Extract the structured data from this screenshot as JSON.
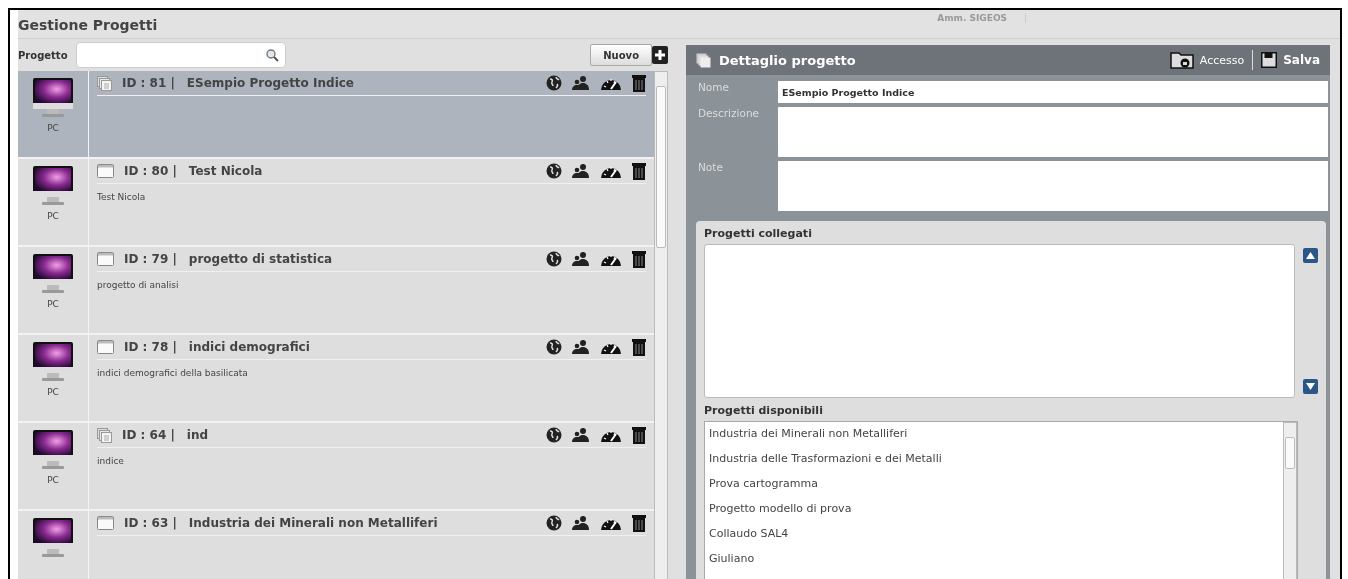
{
  "header": {
    "title": "Gestione Progetti",
    "user": "Amm. SIGEOS"
  },
  "search": {
    "label": "Progetto"
  },
  "new_button": "Nuovo",
  "projects": [
    {
      "kind": "stack",
      "id": "ID : 81 |",
      "name": "ESempio Progetto Indice",
      "device": "PC",
      "selected": true
    },
    {
      "kind": "window",
      "id": "ID : 80 |",
      "name": "Test Nicola",
      "description": "Test Nicola",
      "device": "PC",
      "selected": false
    },
    {
      "kind": "window",
      "id": "ID : 79 |",
      "name": "progetto di statistica",
      "description": "progetto di analisi",
      "device": "PC",
      "selected": false
    },
    {
      "kind": "window",
      "id": "ID : 78 |",
      "name": "indici demografici",
      "description": "indici demografici della basilicata",
      "device": "PC",
      "selected": false
    },
    {
      "kind": "stack",
      "id": "ID : 64 |",
      "name": "ind",
      "description": "indice",
      "device": "PC",
      "selected": false
    },
    {
      "kind": "window",
      "id": "ID : 63 |",
      "name": "Industria dei Minerali non Metalliferi",
      "selected": false
    }
  ],
  "detail": {
    "title": "Dettaglio progetto",
    "access_button": "Accesso",
    "save_button": "Salva",
    "fields": [
      {
        "label": "Nome",
        "value": "ESempio Progetto Indice",
        "kind": "line"
      },
      {
        "label": "Descrizione",
        "kind": "area"
      },
      {
        "label": "Note",
        "kind": "area"
      }
    ]
  },
  "linked": {
    "title": "Progetti collegati"
  },
  "available": {
    "title": "Progetti disponibili",
    "items": [
      "Industria dei Minerali non Metalliferi",
      "Industria delle Trasformazioni e dei Metalli",
      "Prova cartogramma",
      "Progetto modello di prova",
      "Collaudo SAL4",
      "Giuliano"
    ]
  }
}
